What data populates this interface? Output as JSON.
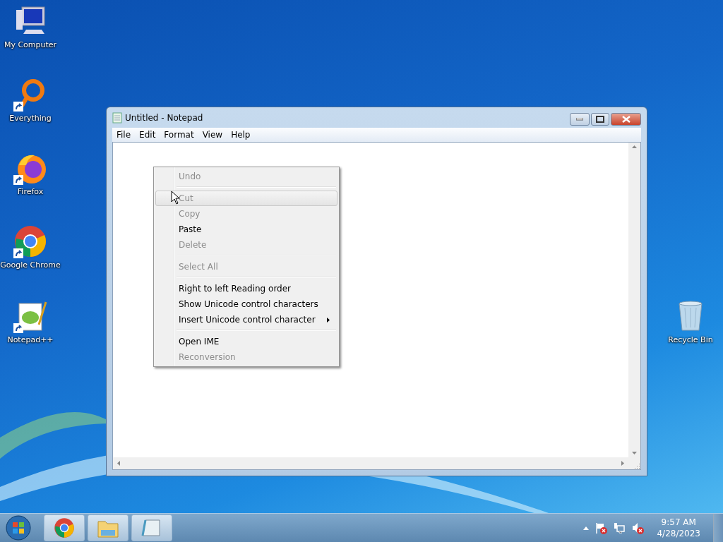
{
  "desktop_icons": [
    {
      "label": "My Computer",
      "kind": "computer",
      "shortcut": false
    },
    {
      "label": "Everything",
      "kind": "everything",
      "shortcut": true
    },
    {
      "label": "Firefox",
      "kind": "firefox",
      "shortcut": true
    },
    {
      "label": "Google Chrome",
      "kind": "chrome",
      "shortcut": true
    },
    {
      "label": "Notepad++",
      "kind": "notepadpp",
      "shortcut": true
    },
    {
      "label": "Recycle Bin",
      "kind": "recycle",
      "shortcut": false
    }
  ],
  "window": {
    "title": "Untitled - Notepad",
    "menu": [
      "File",
      "Edit",
      "Format",
      "View",
      "Help"
    ]
  },
  "context_menu": [
    {
      "kind": "item",
      "label": "Undo",
      "disabled": true,
      "selected": false
    },
    {
      "kind": "separator"
    },
    {
      "kind": "item",
      "label": "Cut",
      "disabled": true,
      "selected": true
    },
    {
      "kind": "item",
      "label": "Copy",
      "disabled": true,
      "selected": false
    },
    {
      "kind": "item",
      "label": "Paste",
      "disabled": false,
      "selected": false
    },
    {
      "kind": "item",
      "label": "Delete",
      "disabled": true,
      "selected": false
    },
    {
      "kind": "separator"
    },
    {
      "kind": "item",
      "label": "Select All",
      "disabled": true,
      "selected": false
    },
    {
      "kind": "separator"
    },
    {
      "kind": "item",
      "label": "Right to left Reading order",
      "disabled": false,
      "selected": false
    },
    {
      "kind": "item",
      "label": "Show Unicode control characters",
      "disabled": false,
      "selected": false
    },
    {
      "kind": "item",
      "label": "Insert Unicode control character",
      "disabled": false,
      "selected": false,
      "submenu": true
    },
    {
      "kind": "separator"
    },
    {
      "kind": "item",
      "label": "Open IME",
      "disabled": false,
      "selected": false
    },
    {
      "kind": "item",
      "label": "Reconversion",
      "disabled": true,
      "selected": false
    }
  ],
  "taskbar": {
    "apps": [
      {
        "kind": "chrome"
      },
      {
        "kind": "explorer"
      },
      {
        "kind": "notepad"
      }
    ],
    "tray": [
      {
        "kind": "flag"
      },
      {
        "kind": "network"
      },
      {
        "kind": "volume"
      }
    ],
    "time": "9:57 AM",
    "date": "4/28/2023"
  }
}
